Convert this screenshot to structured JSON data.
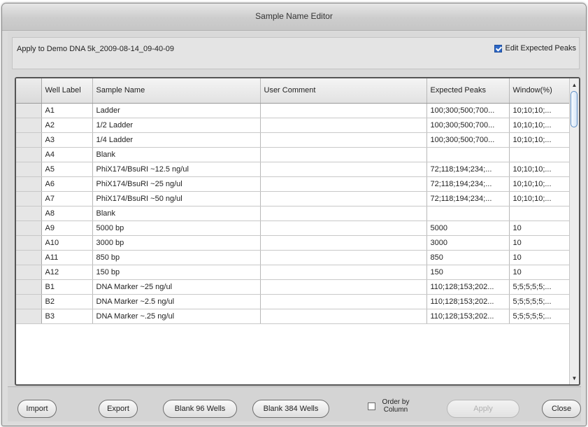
{
  "window": {
    "title": "Sample Name Editor"
  },
  "apply_bar": {
    "label": "Apply to Demo DNA 5k_2009-08-14_09-40-09",
    "edit_expected_peaks_label": "Edit Expected Peaks",
    "edit_expected_peaks_checked": true
  },
  "table": {
    "headers": {
      "well_label": "Well Label",
      "sample_name": "Sample Name",
      "user_comment": "User Comment",
      "expected_peaks": "Expected Peaks",
      "window_pct": "Window(%)"
    },
    "rows": [
      {
        "well": "A1",
        "name": "Ladder",
        "comment": "",
        "peaks": "100;300;500;700...",
        "window": "10;10;10;..."
      },
      {
        "well": "A2",
        "name": "1/2 Ladder",
        "comment": "",
        "peaks": "100;300;500;700...",
        "window": "10;10;10;..."
      },
      {
        "well": "A3",
        "name": "1/4 Ladder",
        "comment": "",
        "peaks": "100;300;500;700...",
        "window": "10;10;10;..."
      },
      {
        "well": "A4",
        "name": "Blank",
        "comment": "",
        "peaks": "",
        "window": ""
      },
      {
        "well": "A5",
        "name": "PhiX174/BsuRI ~12.5 ng/ul",
        "comment": "",
        "peaks": "72;118;194;234;...",
        "window": "10;10;10;..."
      },
      {
        "well": "A6",
        "name": "PhiX174/BsuRI ~25 ng/ul",
        "comment": "",
        "peaks": "72;118;194;234;...",
        "window": "10;10;10;..."
      },
      {
        "well": "A7",
        "name": "PhiX174/BsuRI ~50 ng/ul",
        "comment": "",
        "peaks": "72;118;194;234;...",
        "window": "10;10;10;..."
      },
      {
        "well": "A8",
        "name": "Blank",
        "comment": "",
        "peaks": "",
        "window": ""
      },
      {
        "well": "A9",
        "name": "5000 bp",
        "comment": "",
        "peaks": "5000",
        "window": "10"
      },
      {
        "well": "A10",
        "name": "3000 bp",
        "comment": "",
        "peaks": "3000",
        "window": "10"
      },
      {
        "well": "A11",
        "name": "850 bp",
        "comment": "",
        "peaks": "850",
        "window": "10"
      },
      {
        "well": "A12",
        "name": "150 bp",
        "comment": "",
        "peaks": "150",
        "window": "10"
      },
      {
        "well": "B1",
        "name": "DNA Marker ~25 ng/ul",
        "comment": "",
        "peaks": "110;128;153;202...",
        "window": "5;5;5;5;5;..."
      },
      {
        "well": "B2",
        "name": "DNA Marker ~2.5 ng/ul",
        "comment": "",
        "peaks": "110;128;153;202...",
        "window": "5;5;5;5;5;..."
      },
      {
        "well": "B3",
        "name": "DNA Marker ~.25 ng/ul",
        "comment": "",
        "peaks": "110;128;153;202...",
        "window": "5;5;5;5;5;..."
      }
    ]
  },
  "scrollbar": {
    "up_icon": "▲",
    "down_icon": "▼"
  },
  "buttons": {
    "import": "Import",
    "export": "Export",
    "blank96": "Blank 96 Wells",
    "blank384": "Blank 384 Wells",
    "order_by_column": "Order by Column",
    "order_by_column_checked": false,
    "apply": "Apply",
    "close": "Close"
  }
}
